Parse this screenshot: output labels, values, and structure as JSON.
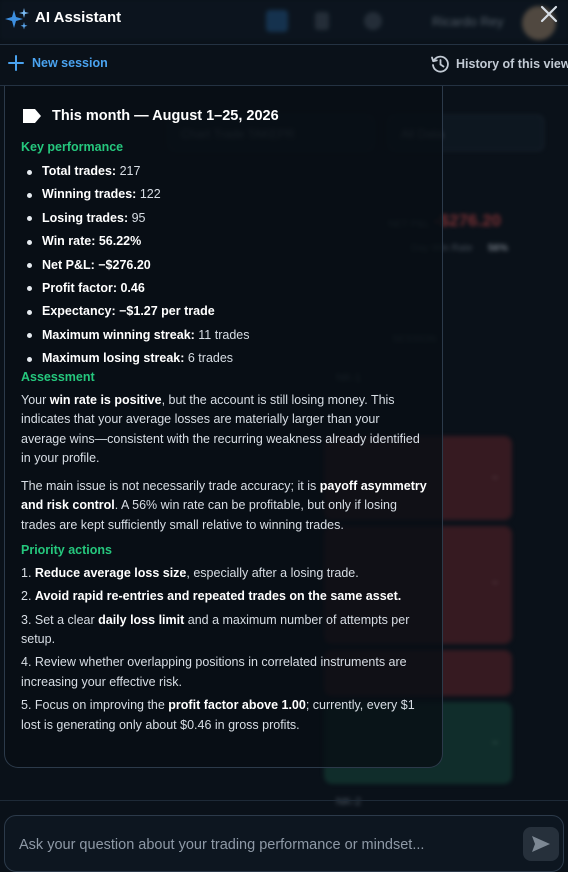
{
  "header": {
    "title": "AI Assistant",
    "spark_icon": "sparkle-icon",
    "close_icon": "close-icon"
  },
  "session_bar": {
    "new_session": "New session",
    "history": "History of this view"
  },
  "background": {
    "user_name": "Ricardo Rey",
    "select_1": "Chart Trade TAKEPR",
    "select_2": "All Data",
    "net_value": "-$276.20",
    "net_label": "NET P&L",
    "win_label": "Day Win Rate",
    "win_value": "56%",
    "column_label": "SESSION",
    "rows": [
      "NK-1",
      "NK-2"
    ]
  },
  "message": {
    "title": "This month — August 1–25, 2026",
    "key_performance": {
      "heading": "Key performance",
      "items": [
        {
          "label": "Total trades:",
          "value": " 217"
        },
        {
          "label": "Winning trades:",
          "value": " 122"
        },
        {
          "label": "Losing trades:",
          "value": " 95"
        },
        {
          "label": "Win rate: 56.22%",
          "value": ""
        },
        {
          "label": "Net P&L: −$276.20",
          "value": ""
        },
        {
          "label": "Profit factor: 0.46",
          "value": ""
        },
        {
          "label": "Expectancy: −$1.27 per trade",
          "value": ""
        },
        {
          "label": "Maximum winning streak:",
          "value": " 11 trades"
        },
        {
          "label": "Maximum losing streak:",
          "value": " 6 trades"
        }
      ]
    },
    "assessment": {
      "heading": "Assessment",
      "p1": [
        {
          "t": "Your ",
          "b": false
        },
        {
          "t": "win rate is positive",
          "b": true
        },
        {
          "t": ", but the account is still losing money. This indicates that your average losses are materially larger than your average wins—consistent with the recurring weakness already identified in your profile.",
          "b": false
        }
      ],
      "p2": [
        {
          "t": "The main issue is not necessarily trade accuracy; it is ",
          "b": false
        },
        {
          "t": "payoff asymmetry and risk control",
          "b": true
        },
        {
          "t": ". A 56% win rate can be profitable, but only if losing trades are kept sufficiently small relative to winning trades.",
          "b": false
        }
      ]
    },
    "priority_actions": {
      "heading": "Priority actions",
      "items": [
        [
          {
            "t": "1. ",
            "b": false
          },
          {
            "t": "Reduce average loss size",
            "b": true
          },
          {
            "t": ", especially after a losing trade.",
            "b": false
          }
        ],
        [
          {
            "t": "2. ",
            "b": false
          },
          {
            "t": "Avoid rapid re-entries and repeated trades on the same asset.",
            "b": true
          }
        ],
        [
          {
            "t": "3. Set a clear ",
            "b": false
          },
          {
            "t": "daily loss limit",
            "b": true
          },
          {
            "t": " and a maximum number of attempts per setup.",
            "b": false
          }
        ],
        [
          {
            "t": "4. Review whether overlapping positions in correlated instruments are increasing your effective risk.",
            "b": false
          }
        ],
        [
          {
            "t": "5. Focus on improving the ",
            "b": false
          },
          {
            "t": "profit factor above 1.00",
            "b": true
          },
          {
            "t": "; currently, every $1 lost is generating only about $0.46 in gross profits.",
            "b": false
          }
        ]
      ]
    }
  },
  "input": {
    "placeholder": "Ask your question about your trading performance or mindset...",
    "value": ""
  },
  "colors": {
    "accent_blue": "#4aa3f0",
    "section_green": "#25c77d",
    "loss_red": "#d04848"
  }
}
